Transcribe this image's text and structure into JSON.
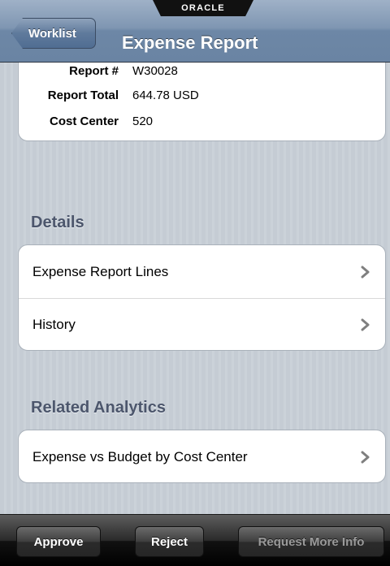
{
  "navbar": {
    "brand": "ORACLE",
    "back_label": "Worklist",
    "title": "Expense Report"
  },
  "summary": {
    "rows": [
      {
        "label": "Report #",
        "value": "W30028"
      },
      {
        "label": "Report Total",
        "value": "644.78 USD"
      },
      {
        "label": "Cost Center",
        "value": "520"
      }
    ]
  },
  "details": {
    "header": "Details",
    "items": [
      {
        "label": "Expense Report Lines",
        "icon": "chevron-right-icon"
      },
      {
        "label": "History",
        "icon": "chevron-right-icon"
      }
    ]
  },
  "analytics": {
    "header": "Related Analytics",
    "items": [
      {
        "label": "Expense vs Budget by Cost Center",
        "icon": "chevron-right-icon"
      }
    ]
  },
  "toolbar": {
    "approve_label": "Approve",
    "reject_label": "Reject",
    "request_info_label": "Request More Info",
    "request_info_enabled": false
  },
  "colors": {
    "nav_blue": "#6d87a6",
    "section_text": "#4c566c",
    "background": "#c5ccd4"
  }
}
